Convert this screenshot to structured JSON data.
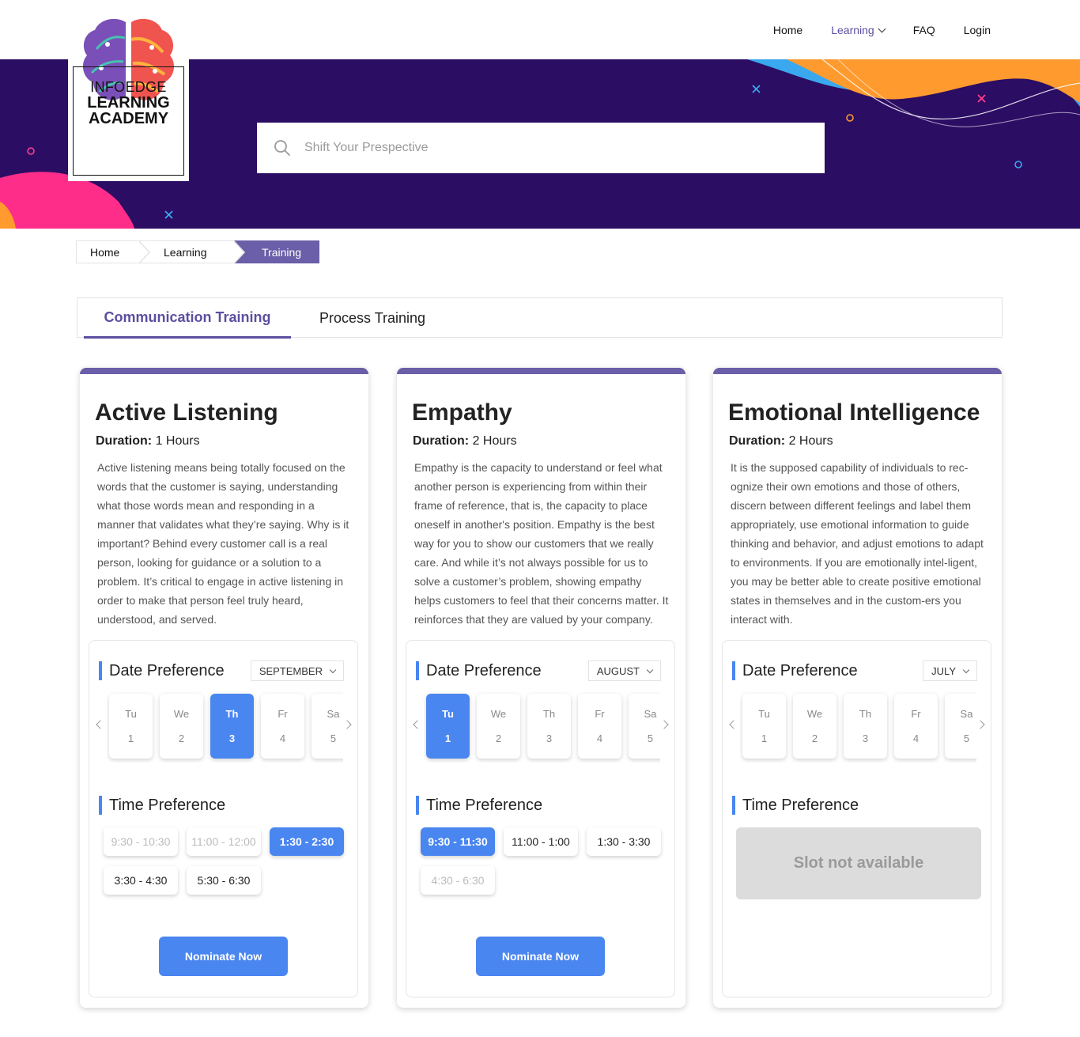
{
  "brand": {
    "line1": "INFOEDGE",
    "line2": "LEARNING",
    "line3": "ACADEMY"
  },
  "nav": {
    "home": "Home",
    "learning": "Learning",
    "faq": "FAQ",
    "login": "Login"
  },
  "search": {
    "placeholder": "Shift Your Prespective"
  },
  "breadcrumb": [
    "Home",
    "Learning",
    "Training"
  ],
  "tabs": [
    "Communication Training",
    "Process Training"
  ],
  "colors": {
    "accent": "#6a5fa8",
    "primary_blue": "#4a86f0",
    "hero_bg": "#2c0d64"
  },
  "cards": [
    {
      "title": "Active Listening",
      "duration_label": "Duration:",
      "duration": "1 Hours",
      "description": "Active listening means being totally focused on the words that the customer is saying, understanding what those words mean and responding in a manner that validates what they’re saying. Why is it important? Behind every customer call is a real person, looking for guidance or a solution to a problem. It’s critical to engage in active listening in order to make that person feel truly heard, understood, and served.",
      "date_title": "Date Preference",
      "month": "SEPTEMBER",
      "days": [
        {
          "name": "Tu",
          "num": "1"
        },
        {
          "name": "We",
          "num": "2"
        },
        {
          "name": "Th",
          "num": "3"
        },
        {
          "name": "Fr",
          "num": "4"
        },
        {
          "name": "Sa",
          "num": "5"
        }
      ],
      "time_title": "Time Preference",
      "times": [
        "9:30 - 10:30",
        "11:00 - 12:00",
        "1:30 - 2:30",
        "3:30 - 4:30",
        "5:30 - 6:30"
      ],
      "button": "Nominate Now"
    },
    {
      "title": "Empathy",
      "duration_label": "Duration:",
      "duration": "2 Hours",
      "description": "Empathy is the capacity to understand or feel what another person is experiencing from within their frame of reference, that is, the capacity to place oneself in another's position. Empathy is the best way for you to show our customers that we really care. And while it’s not always possible for us to solve a customer’s problem, showing empathy helps customers to feel that their concerns matter. It reinforces that they are valued by your company.",
      "date_title": "Date Preference",
      "month": "AUGUST",
      "days": [
        {
          "name": "Tu",
          "num": "1"
        },
        {
          "name": "We",
          "num": "2"
        },
        {
          "name": "Th",
          "num": "3"
        },
        {
          "name": "Fr",
          "num": "4"
        },
        {
          "name": "Sa",
          "num": "5"
        }
      ],
      "time_title": "Time Preference",
      "times": [
        "9:30 - 11:30",
        "11:00 - 1:00",
        "1:30 - 3:30",
        "4:30 - 6:30"
      ],
      "button": "Nominate Now"
    },
    {
      "title": "Emotional Intelligence",
      "duration_label": "Duration:",
      "duration": "2 Hours",
      "description": "It is the supposed capability of individuals to rec-ognize their own emotions and those of others, discern between different feelings and label them appropriately, use emotional information to guide thinking and behavior, and adjust emotions to adapt to environments. If you are emotionally intel-ligent, you may be better able to create positive emotional states in themselves and in the custom-ers you interact with.",
      "date_title": "Date Preference",
      "month": "JULY",
      "days": [
        {
          "name": "Tu",
          "num": "1"
        },
        {
          "name": "We",
          "num": "2"
        },
        {
          "name": "Th",
          "num": "3"
        },
        {
          "name": "Fr",
          "num": "4"
        },
        {
          "name": "Sa",
          "num": "5"
        }
      ],
      "time_title": "Time Preference",
      "slot_message": "Slot not available"
    }
  ]
}
